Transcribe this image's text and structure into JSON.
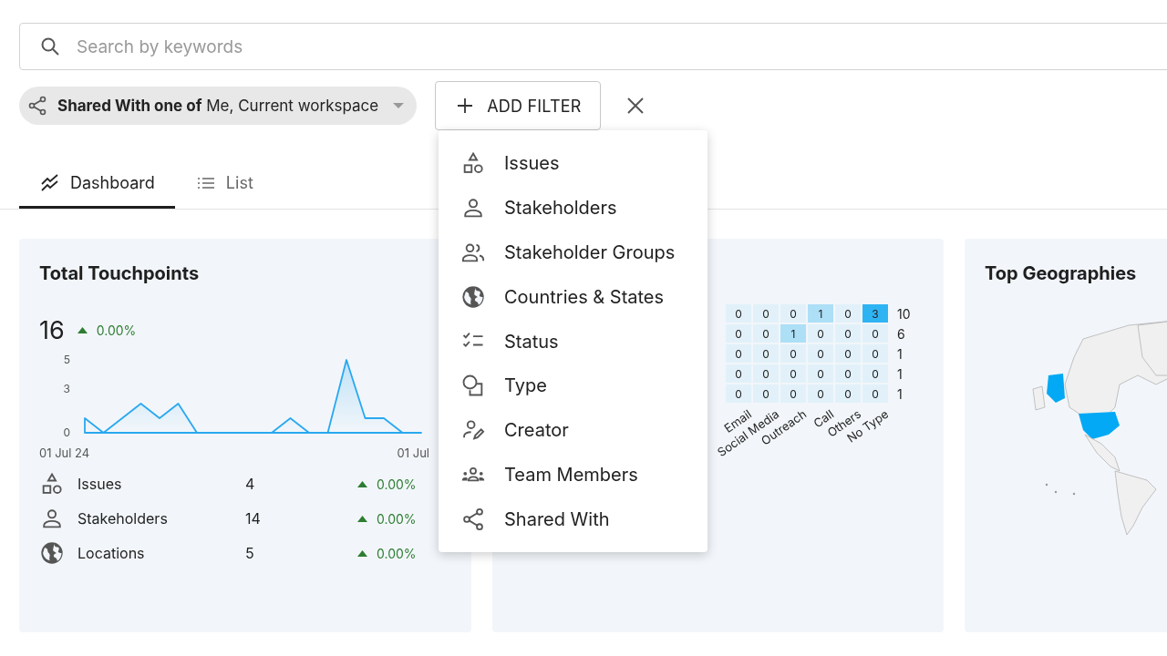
{
  "search": {
    "placeholder": "Search by keywords"
  },
  "filter_chip": {
    "label": "**Shared With one of** Me, Current workspace"
  },
  "add_filter": {
    "label": "ADD FILTER"
  },
  "tabs": [
    {
      "label": "Dashboard",
      "selected": true
    },
    {
      "label": "List",
      "selected": false
    }
  ],
  "touchpoints_card": {
    "title": "Total Touchpoints",
    "total": "16",
    "change": "0.00%",
    "chart_data": {
      "type": "area",
      "yticks": [
        0,
        3,
        5
      ],
      "ylim": [
        0,
        5
      ],
      "series": [
        {
          "color": "#29a8f0",
          "values": [
            1,
            0,
            1,
            2,
            1,
            2,
            0,
            0,
            0,
            0,
            0,
            1,
            0,
            0,
            5,
            1,
            1,
            0,
            0
          ]
        }
      ]
    },
    "x_labels": [
      "01 Jul 24",
      "01 Jul"
    ],
    "metrics": [
      {
        "label": "Issues",
        "value": "4",
        "change": "0.00%"
      },
      {
        "label": "Stakeholders",
        "value": "14",
        "change": "0.00%"
      },
      {
        "label": "Locations",
        "value": "5",
        "change": "0.00%"
      }
    ]
  },
  "heatmap_card": {
    "rows": [
      {
        "cells": [
          "0",
          "0",
          "0",
          "1",
          "0",
          "3"
        ],
        "total": "10"
      },
      {
        "cells": [
          "0",
          "0",
          "1",
          "0",
          "0",
          "0"
        ],
        "total": "6"
      },
      {
        "cells": [
          "0",
          "0",
          "0",
          "0",
          "0",
          "0"
        ],
        "total": "1"
      },
      {
        "cells": [
          "0",
          "0",
          "0",
          "0",
          "0",
          "0"
        ],
        "total": "1"
      },
      {
        "cells": [
          "0",
          "0",
          "0",
          "0",
          "0",
          "0"
        ],
        "total": "1"
      }
    ],
    "x_axis_labels": [
      "Email",
      "Social Media",
      "Outreach",
      "Call",
      "Others",
      "No Type"
    ]
  },
  "geo_card": {
    "title": "Top Geographies"
  },
  "filter_menu": [
    {
      "label": "Issues"
    },
    {
      "label": "Stakeholders"
    },
    {
      "label": "Stakeholder Groups"
    },
    {
      "label": "Countries & States"
    },
    {
      "label": "Status"
    },
    {
      "label": "Type"
    },
    {
      "label": "Creator"
    },
    {
      "label": "Team Members"
    },
    {
      "label": "Shared With"
    }
  ]
}
